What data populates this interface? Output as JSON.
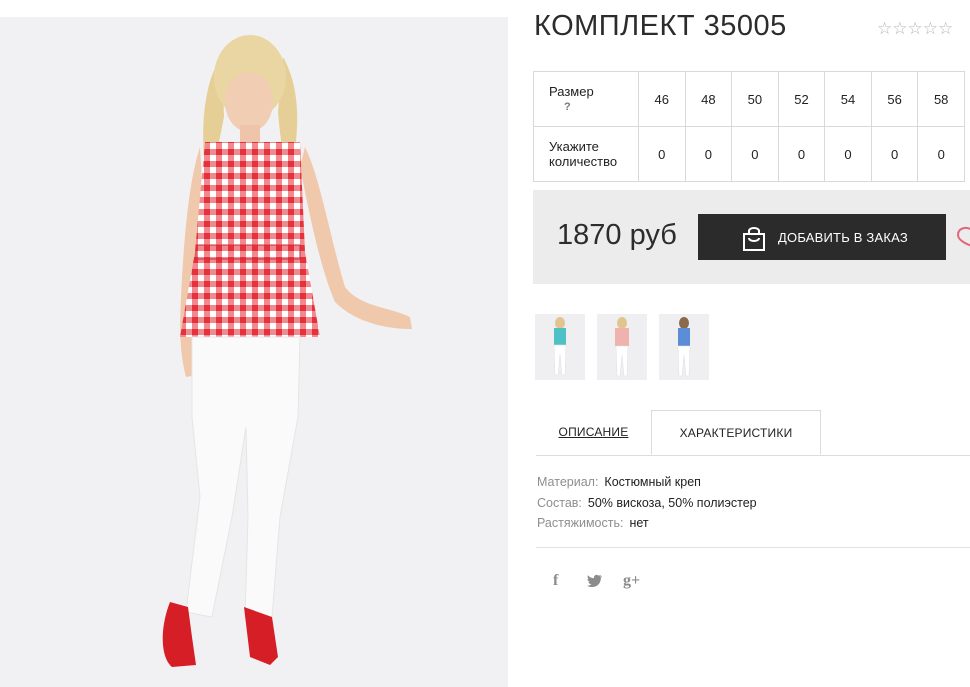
{
  "product": {
    "title": "КОМПЛЕКТ 35005",
    "rating_stars": [
      "☆",
      "☆",
      "☆",
      "☆",
      "☆"
    ]
  },
  "sizes_table": {
    "size_label": "Размер",
    "help_mark": "?",
    "sizes": [
      "46",
      "48",
      "50",
      "52",
      "54",
      "56",
      "58"
    ],
    "qty_label_1": "Укажите",
    "qty_label_2": "количество",
    "quantities": [
      "0",
      "0",
      "0",
      "0",
      "0",
      "0",
      "0"
    ]
  },
  "buy": {
    "price": "1870 руб",
    "add_button": "ДОБАВИТЬ В ЗАКАЗ"
  },
  "thumbnails": [
    {
      "name": "thumb-turquoise",
      "top_color": "#4fc1c6"
    },
    {
      "name": "thumb-pink",
      "top_color": "#f0b2ad"
    },
    {
      "name": "thumb-blue",
      "top_color": "#5b8ed6"
    }
  ],
  "tabs": {
    "description": "ОПИСАНИЕ",
    "characteristics": "ХАРАКТЕРИСТИКИ"
  },
  "characteristics": [
    {
      "key": "Материал:",
      "value": "Костюмный креп"
    },
    {
      "key": "Состав:",
      "value": "50% вискоза, 50% полиэстер"
    },
    {
      "key": "Растяжимость:",
      "value": "нет"
    }
  ],
  "social": {
    "facebook": "f",
    "twitter": "twitter-bird",
    "gplus": "g+"
  },
  "colors": {
    "button_bg": "#2b2b2b",
    "buybar_bg": "#ececec",
    "heart": "#e3677b",
    "gingham_red": "#e8343e"
  }
}
